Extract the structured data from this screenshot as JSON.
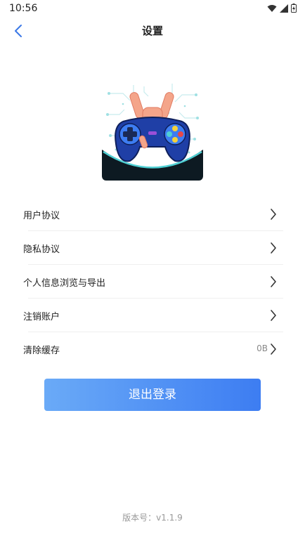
{
  "status_bar": {
    "time": "10:56",
    "icons": [
      "wifi-icon",
      "signal-icon",
      "battery-charging-icon"
    ]
  },
  "nav": {
    "title": "设置",
    "back_icon": "chevron-left-icon",
    "accent": "#3b78e7"
  },
  "logo": {
    "icon": "game-controller-hand-logo"
  },
  "menu": [
    {
      "label": "用户协议",
      "value": ""
    },
    {
      "label": "隐私协议",
      "value": ""
    },
    {
      "label": "个人信息浏览与导出",
      "value": ""
    },
    {
      "label": "注销账户",
      "value": ""
    },
    {
      "label": "清除缓存",
      "value": "0B"
    }
  ],
  "logout": {
    "label": "退出登录",
    "gradient": [
      "#6aaaf7",
      "#3d7df2"
    ]
  },
  "version": "版本号：v1.1.9"
}
